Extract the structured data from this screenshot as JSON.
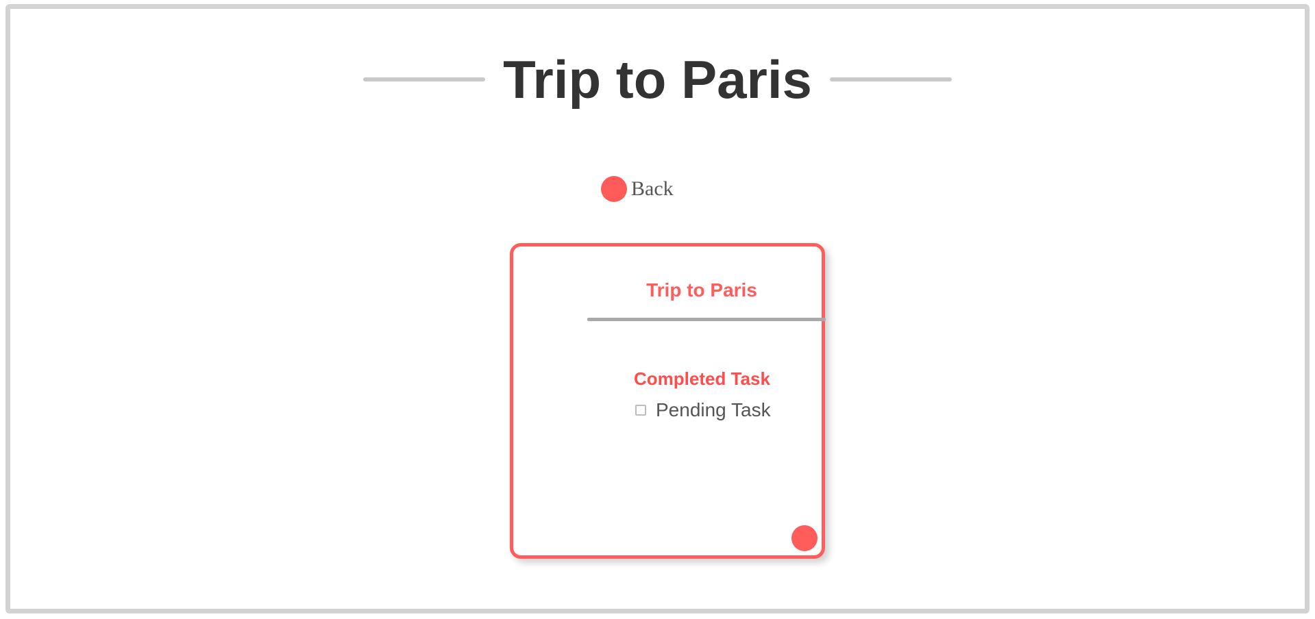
{
  "header": {
    "title": "Trip to Paris"
  },
  "back": {
    "label": "Back"
  },
  "card": {
    "title": "Trip to Paris",
    "tasks": [
      {
        "label": "Completed Task",
        "completed": true
      },
      {
        "label": "Pending Task",
        "completed": false
      }
    ]
  },
  "colors": {
    "accent": "#ff5c5c",
    "title_text": "#333333",
    "frame_border": "#d3d3d3"
  },
  "icons": {
    "back": "back-dot-icon",
    "card_action": "add-task-icon"
  }
}
